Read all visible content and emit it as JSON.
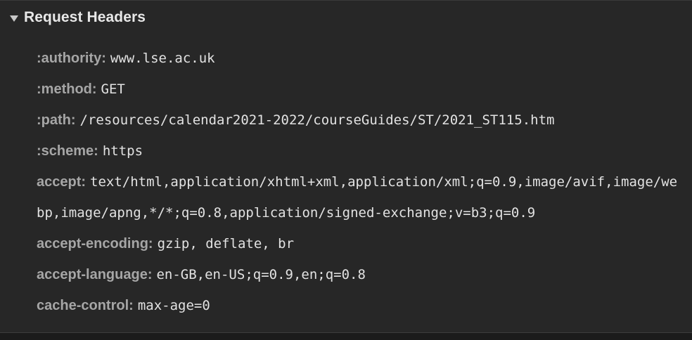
{
  "section": {
    "title": "Request Headers",
    "expanded_icon": "triangle-down-icon"
  },
  "headers": [
    {
      "key": ":authority:",
      "value": "www.lse.ac.uk"
    },
    {
      "key": ":method:",
      "value": "GET"
    },
    {
      "key": ":path:",
      "value": "/resources/calendar2021-2022/courseGuides/ST/2021_ST115.htm"
    },
    {
      "key": ":scheme:",
      "value": "https"
    },
    {
      "key": "accept:",
      "value": "text/html,application/xhtml+xml,application/xml;q=0.9,image/avif,image/webp,image/apng,*/*;q=0.8,application/signed-exchange;v=b3;q=0.9"
    },
    {
      "key": "accept-encoding:",
      "value": "gzip, deflate, br"
    },
    {
      "key": "accept-language:",
      "value": "en-GB,en-US;q=0.9,en;q=0.8"
    },
    {
      "key": "cache-control:",
      "value": "max-age=0"
    }
  ]
}
